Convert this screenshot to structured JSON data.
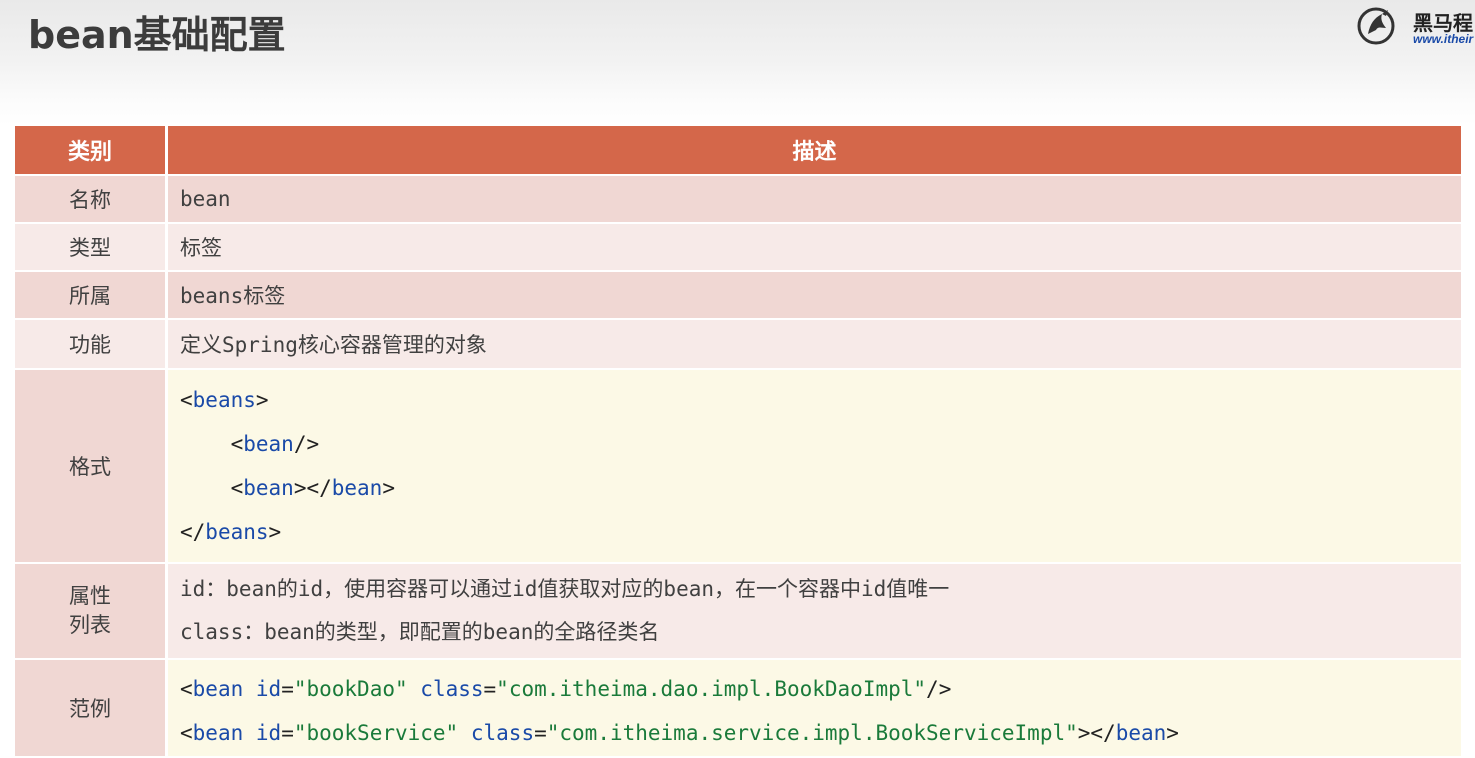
{
  "title": "bean基础配置",
  "logo": {
    "name": "黑马程",
    "url": "www.itheir"
  },
  "table": {
    "headers": [
      "类别",
      "描述"
    ],
    "rows": [
      {
        "category": "名称",
        "value": "bean"
      },
      {
        "category": "类型",
        "value": "标签"
      },
      {
        "category": "所属",
        "value": "beans标签"
      },
      {
        "category": "功能",
        "value": "定义Spring核心容器管理的对象"
      }
    ],
    "format": {
      "category": "格式",
      "lines": [
        {
          "indent": "",
          "open": "<",
          "tag": "beans",
          "close": ">"
        },
        {
          "indent": "    ",
          "open": "<",
          "tag": "bean",
          "close": "/>"
        },
        {
          "indent": "    ",
          "open": "<",
          "tag": "bean",
          "close": "></",
          "tag2": "bean",
          "close2": ">"
        },
        {
          "indent": "",
          "open": "</",
          "tag": "beans",
          "close": ">"
        }
      ]
    },
    "attributes": {
      "category": "属性\n列表",
      "category_line1": "属性",
      "category_line2": "列表",
      "lines": [
        "id：bean的id，使用容器可以通过id值获取对应的bean，在一个容器中id值唯一",
        "class：bean的类型，即配置的bean的全路径类名"
      ]
    },
    "example": {
      "category": "范例",
      "line1": {
        "open": "<",
        "tag": "bean",
        "sp1": " ",
        "a1": "id",
        "eq1": "=",
        "v1": "\"bookDao\"",
        "sp2": " ",
        "a2": "class",
        "eq2": "=",
        "v2": "\"com.itheima.dao.impl.BookDaoImpl\"",
        "end": "/>"
      },
      "line2": {
        "open": "<",
        "tag": "bean",
        "sp1": " ",
        "a1": "id",
        "eq1": "=",
        "v1": "\"bookService\"",
        "sp2": " ",
        "a2": "class",
        "eq2": "=",
        "v2": "\"com.itheima.service.impl.BookServiceImpl\"",
        "end": "></",
        "tag2": "bean",
        "end2": ">"
      }
    }
  }
}
